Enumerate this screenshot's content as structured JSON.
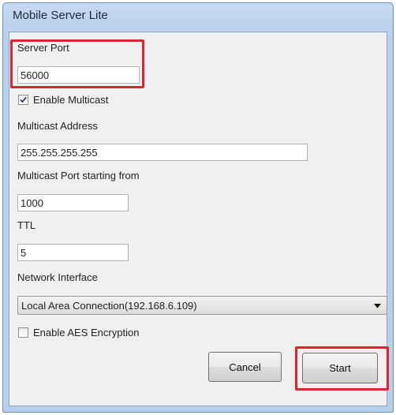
{
  "window": {
    "title": "Mobile Server Lite"
  },
  "form": {
    "server_port_label": "Server Port",
    "server_port_value": "56000",
    "enable_multicast_label": "Enable Multicast",
    "enable_multicast_checked": true,
    "multicast_address_label": "Multicast Address",
    "multicast_address_value": "255.255.255.255",
    "multicast_port_label": "Multicast Port starting from",
    "multicast_port_value": "1000",
    "ttl_label": "TTL",
    "ttl_value": "5",
    "network_interface_label": "Network Interface",
    "network_interface_selected": "Local Area Connection(192.168.6.109)",
    "enable_aes_label": "Enable AES Encryption",
    "enable_aes_checked": false
  },
  "buttons": {
    "cancel": "Cancel",
    "start": "Start"
  },
  "colors": {
    "highlight": "#e0242e",
    "titlebar": "#b9d1ec"
  },
  "icons": {
    "dropdown": "chevron-down-icon",
    "checkmark": "checkmark-icon"
  }
}
